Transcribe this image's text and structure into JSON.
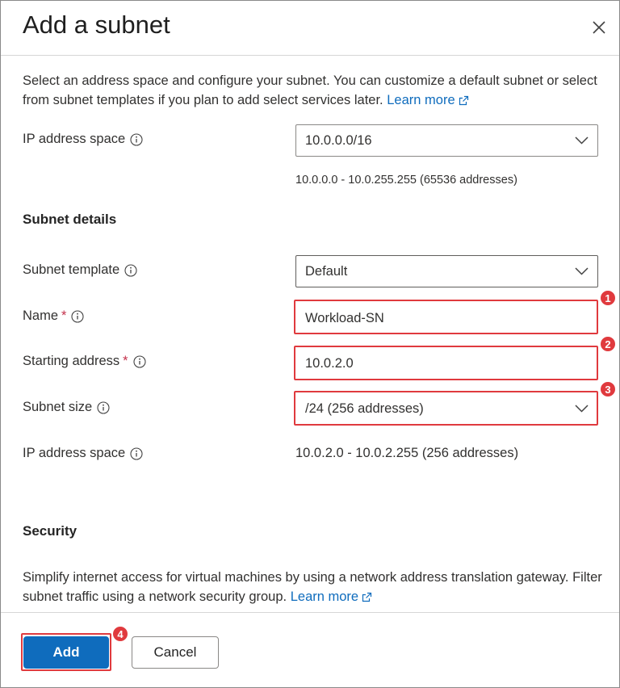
{
  "panel": {
    "title": "Add a subnet",
    "close_icon": "close-icon"
  },
  "intro": {
    "text": "Select an address space and configure your subnet. You can customize a default subnet or select from subnet templates if you plan to add select services later.",
    "learn_more": "Learn more"
  },
  "ip_space": {
    "label": "IP address space",
    "value": "10.0.0.0/16",
    "range_text": "10.0.0.0 - 10.0.255.255 (65536 addresses)"
  },
  "subnet_details": {
    "heading": "Subnet details",
    "template": {
      "label": "Subnet template",
      "value": "Default"
    },
    "name": {
      "label": "Name",
      "required": "*",
      "value": "Workload-SN"
    },
    "starting_address": {
      "label": "Starting address",
      "required": "*",
      "value": "10.0.2.0"
    },
    "size": {
      "label": "Subnet size",
      "value": "/24 (256 addresses)"
    },
    "ip_space": {
      "label": "IP address space",
      "value": "10.0.2.0 - 10.0.2.255 (256 addresses)"
    }
  },
  "security": {
    "heading": "Security",
    "text": "Simplify internet access for virtual machines by using a network address translation gateway. Filter subnet traffic using a network security group.",
    "learn_more": "Learn more"
  },
  "footer": {
    "add_label": "Add",
    "cancel_label": "Cancel"
  },
  "callouts": [
    "1",
    "2",
    "3",
    "4"
  ],
  "colors": {
    "accent": "#0f6cbd",
    "highlight": "#e03a3e",
    "required": "#c4314b"
  }
}
